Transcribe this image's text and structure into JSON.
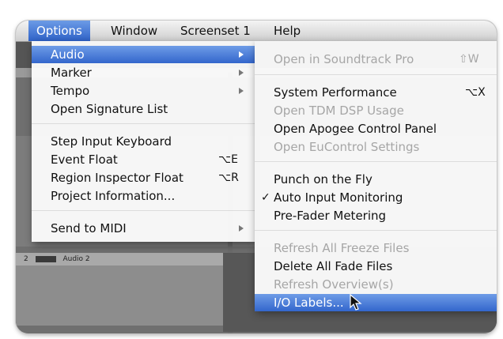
{
  "menubar": {
    "items": [
      {
        "label": "Options",
        "active": true
      },
      {
        "label": "Window"
      },
      {
        "label": "Screenset 1"
      },
      {
        "label": "Help"
      }
    ]
  },
  "options_menu": {
    "items": [
      {
        "label": "Audio",
        "submenu": true,
        "highlighted": true
      },
      {
        "label": "Marker",
        "submenu": true
      },
      {
        "label": "Tempo",
        "submenu": true
      },
      {
        "label": "Open Signature List"
      },
      {
        "label": "Step Input Keyboard"
      },
      {
        "label": "Event Float",
        "shortcut": "⌥E"
      },
      {
        "label": "Region Inspector Float",
        "shortcut": "⌥R"
      },
      {
        "label": "Project Information..."
      },
      {
        "label": "Send to MIDI",
        "submenu": true
      }
    ]
  },
  "audio_submenu": {
    "items": [
      {
        "label": "Open in Soundtrack Pro",
        "shortcut": "⇧W",
        "disabled": true
      },
      {
        "label": "System Performance",
        "shortcut": "⌥X"
      },
      {
        "label": "Open TDM DSP Usage",
        "disabled": true
      },
      {
        "label": "Open Apogee Control Panel"
      },
      {
        "label": "Open EuControl Settings",
        "disabled": true
      },
      {
        "label": "Punch on the Fly"
      },
      {
        "label": "Auto Input Monitoring",
        "checked": true,
        "check_mark": "✓"
      },
      {
        "label": "Pre-Fader Metering"
      },
      {
        "label": "Refresh All Freeze Files",
        "disabled": true
      },
      {
        "label": "Delete All Fade Files"
      },
      {
        "label": "Refresh Overview(s)",
        "disabled": true
      },
      {
        "label": "I/O Labels...",
        "highlighted": true
      }
    ]
  },
  "background": {
    "track_label": "Audio 2",
    "track_number": "2"
  },
  "colors": {
    "highlight": "#3366cc",
    "menu_bg": "#fafafa",
    "disabled_text": "#a6a6a6"
  }
}
